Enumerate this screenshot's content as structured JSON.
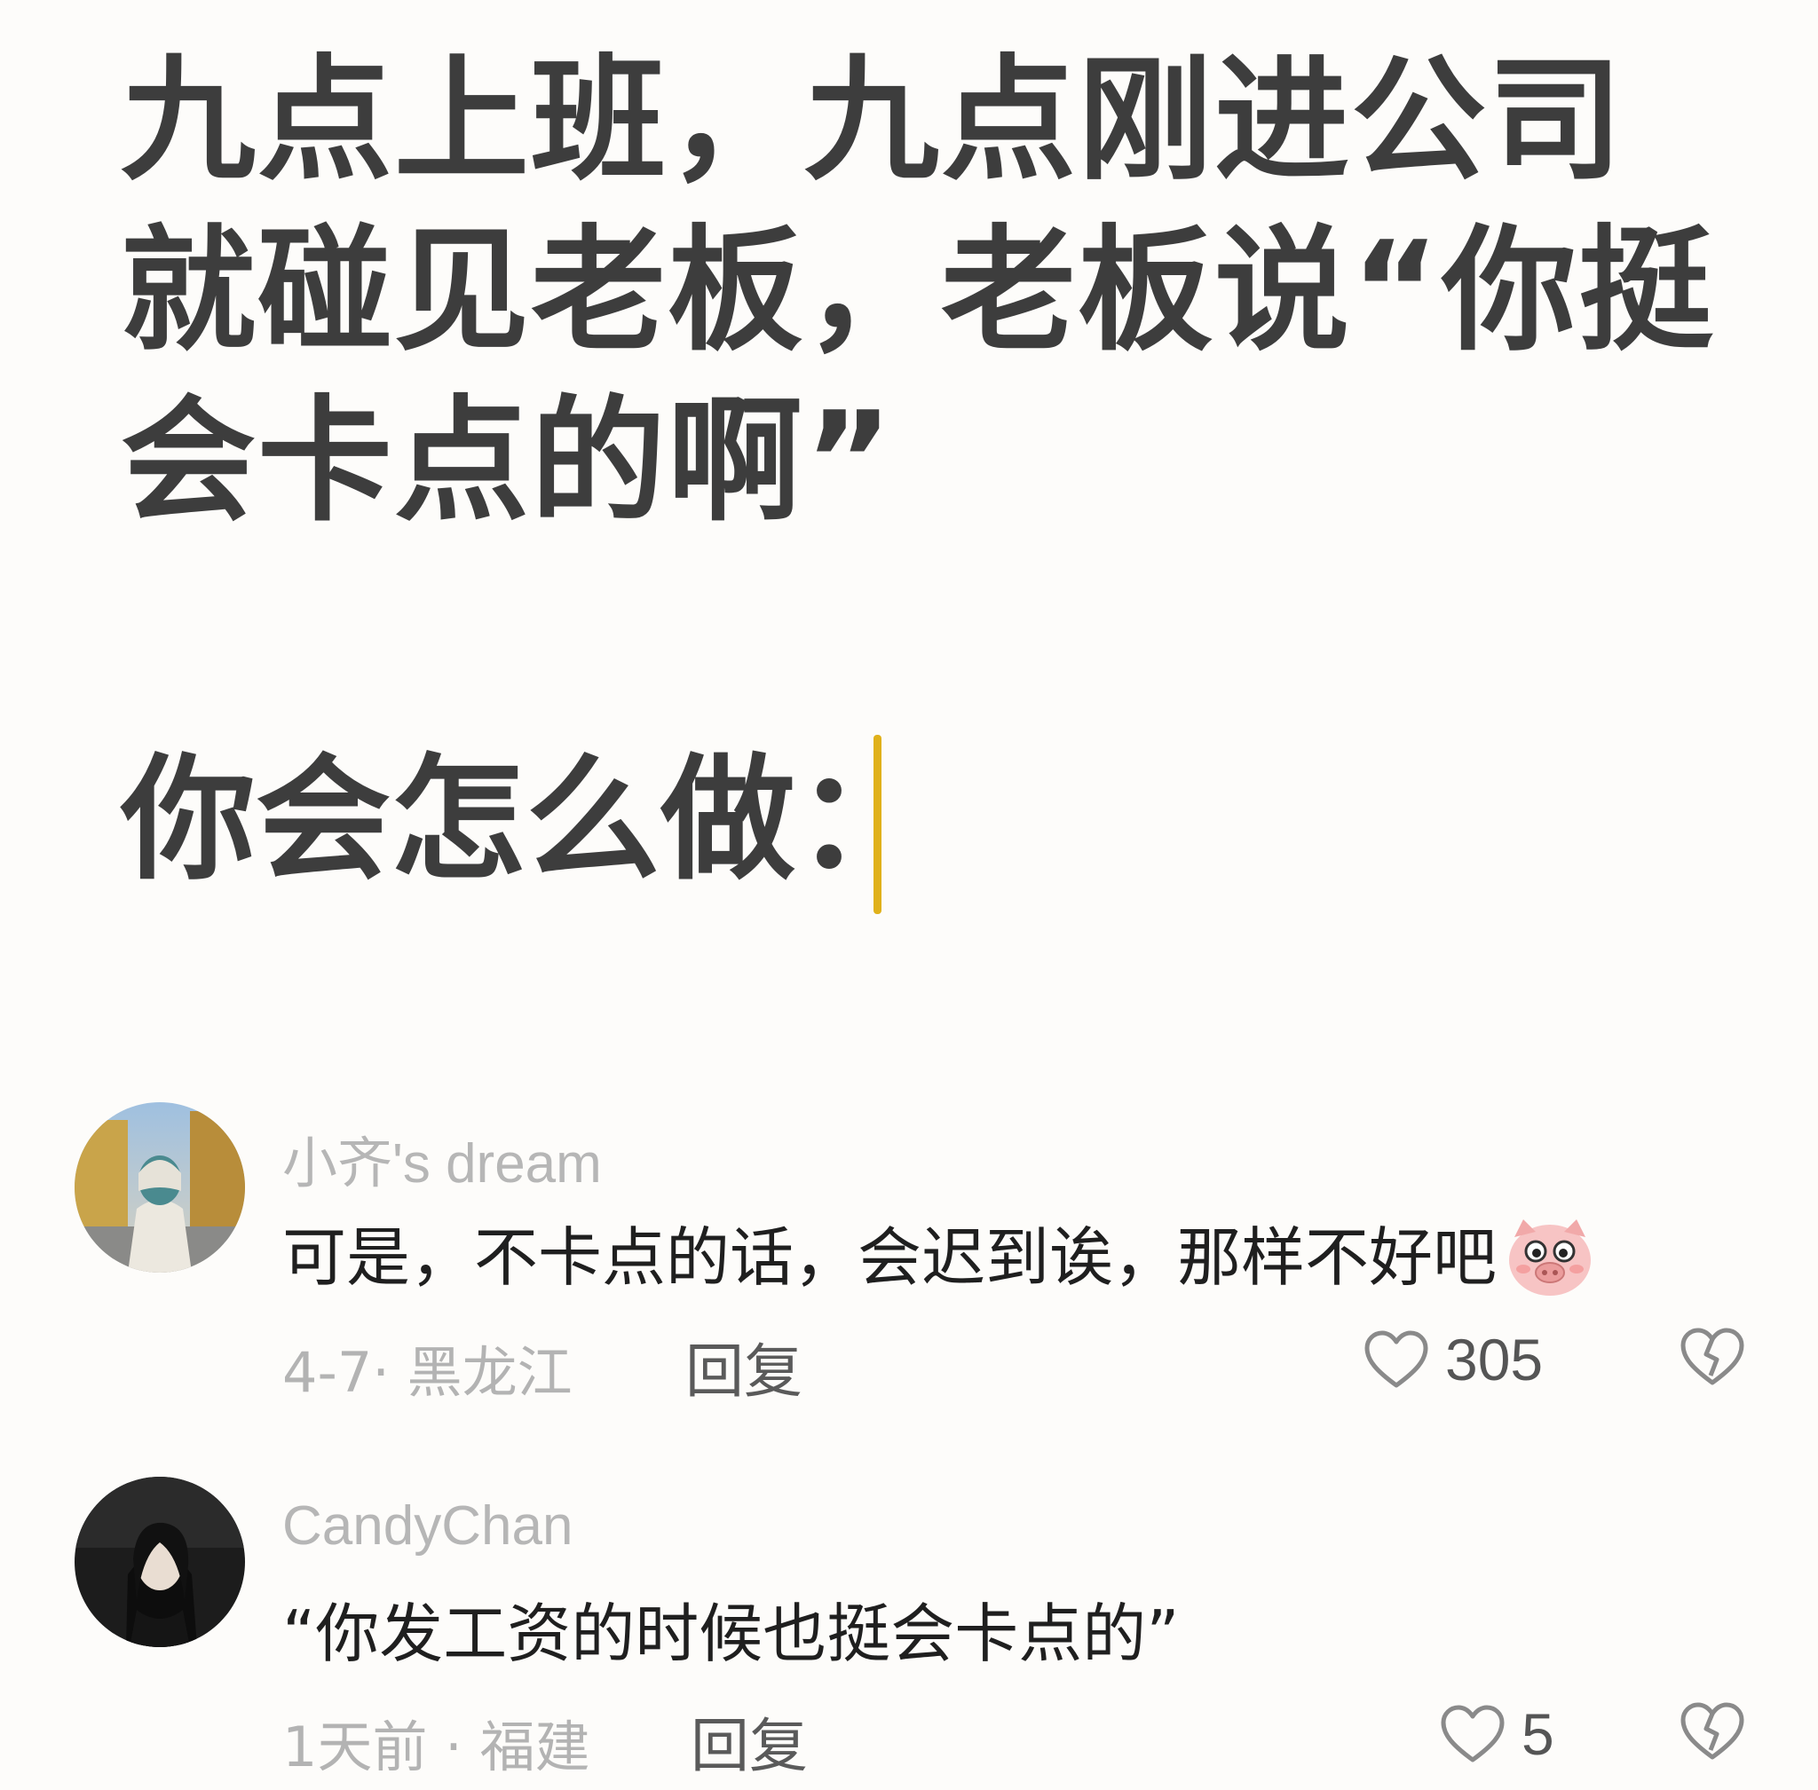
{
  "post": {
    "title_lines": [
      "九点上班，九点刚进公司",
      "就碰见老板，老板说“你挺",
      "会卡点的啊”"
    ],
    "prompt": "你会怎么做："
  },
  "comments": [
    {
      "username": "小齐's dream",
      "text": "可是，不卡点的话，会迟到诶，那样不好吧",
      "emoji": "pig-face-emoji",
      "meta": "4-7· 黑龙江",
      "reply_label": "回复",
      "likes": "305"
    },
    {
      "username": "CandyChan",
      "text": "“你发工资的时候也挺会卡点的”",
      "meta": "1天前 · 福建",
      "reply_label": "回复",
      "likes": "5"
    }
  ],
  "colors": {
    "cursor": "#e0b11a",
    "headline": "#3d3d3d",
    "username": "#b6b6b6"
  }
}
